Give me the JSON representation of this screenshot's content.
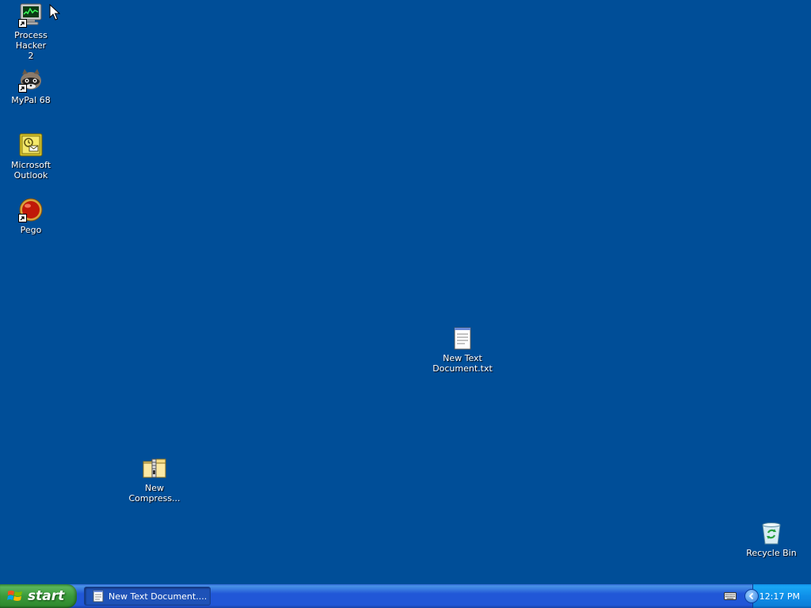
{
  "desktop": {
    "background_color": "#004e98",
    "icons": [
      {
        "label_line1": "Process Hacker",
        "label_line2": "2",
        "icon": "process-hacker-icon",
        "shortcut": true
      },
      {
        "label_line1": "MyPal 68",
        "label_line2": "",
        "icon": "mypal-raccoon-icon",
        "shortcut": true
      },
      {
        "label_line1": "Microsoft",
        "label_line2": "Outlook",
        "icon": "outlook-icon",
        "shortcut": false
      },
      {
        "label_line1": "Pego",
        "label_line2": "",
        "icon": "pego-icon",
        "shortcut": true
      },
      {
        "label_line1": "New Text",
        "label_line2": "Document.txt",
        "icon": "text-document-icon",
        "shortcut": false
      },
      {
        "label_line1": "New",
        "label_line2": "Compress...",
        "icon": "zip-folder-icon",
        "shortcut": false
      },
      {
        "label_line1": "Recycle Bin",
        "label_line2": "",
        "icon": "recycle-bin-icon",
        "shortcut": false
      }
    ]
  },
  "taskbar": {
    "start_label": "start",
    "task_items": [
      {
        "label": "New Text Document....",
        "icon": "notepad-icon"
      }
    ],
    "tray": {
      "clock": "12:17 PM",
      "icons": [
        "keyboard-icon",
        "tray-expand-icon"
      ]
    },
    "colors": {
      "taskbar": "#2157d7",
      "start": "#3a9a3a",
      "tray": "#0f8ee8"
    }
  }
}
